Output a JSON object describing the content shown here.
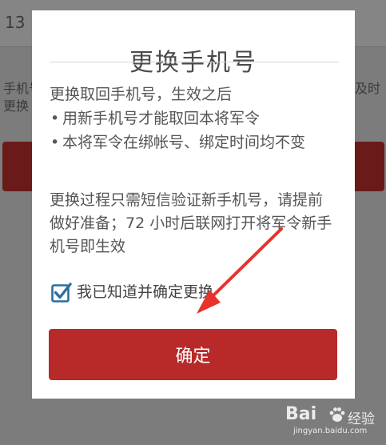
{
  "background": {
    "phone_field_value": "13",
    "hint_left": "手机号\n更换",
    "hint_right": "及时"
  },
  "dialog": {
    "title": "更换手机号",
    "intro": "更换取回手机号，生效之后",
    "bullet_symbol": "•",
    "bullets": [
      "用新手机号才能取回本将军令",
      "本将军令在绑帐号、绑定时间均不变"
    ],
    "process_text": "更换过程只需短信验证新手机号，请提前做好准备；72 小时后联网打开将军令新手机号即生效",
    "checkbox_checked": true,
    "confirm_label": "我已知道并确定更换",
    "ok_button": "确定"
  },
  "watermark": {
    "brand": "Bai",
    "cn": "经验",
    "url": "jingyan.baidu.com"
  },
  "colors": {
    "primary_button": "#b82a2a",
    "annotation_arrow": "#e8322b",
    "checkbox": "#2a6f9e"
  },
  "icons": {
    "checkbox": "checkbox-checked-icon",
    "arrow": "annotation-arrow-icon",
    "watermark_logo": "baidu-paw-icon"
  }
}
